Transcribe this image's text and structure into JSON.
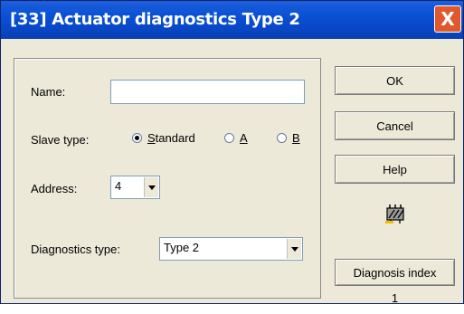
{
  "window": {
    "title": "[33] Actuator diagnostics Type 2",
    "close_glyph": "X"
  },
  "form": {
    "name_label": "Name:",
    "name_value": "",
    "slave_type_label": "Slave type:",
    "slave_type_options": [
      {
        "label": "Standard",
        "selected": true
      },
      {
        "label": "A",
        "selected": false
      },
      {
        "label": "B",
        "selected": false
      }
    ],
    "address_label": "Address:",
    "address_value": "4",
    "diagnostics_type_label": "Diagnostics type:",
    "diagnostics_type_value": "Type 2"
  },
  "buttons": {
    "ok": "OK",
    "cancel": "Cancel",
    "help": "Help",
    "diagnosis_index": "Diagnosis index"
  },
  "diagnosis_index_value": "1",
  "icons": {
    "close": "close-icon",
    "diagnostics": "diagnostics-component-icon",
    "dropdown": "chevron-down-icon"
  },
  "colors": {
    "titlebar": "#0a52d6",
    "close": "#e0582d",
    "dialog_bg": "#ece9d8"
  }
}
